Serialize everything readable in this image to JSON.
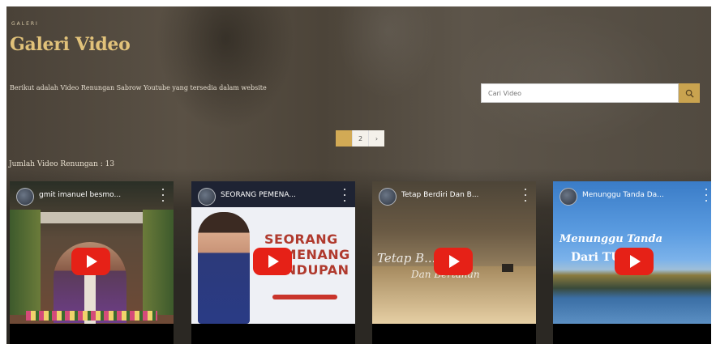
{
  "header": {
    "eyebrow": "GALERI",
    "title": "Galeri Video",
    "description": "Berikut adalah Video Renungan Sabrow Youtube yang tersedia dalam website"
  },
  "search": {
    "placeholder": "Cari Video",
    "icon": "search-icon"
  },
  "pagination": {
    "pages": [
      "1",
      "2",
      "›"
    ],
    "active": "1"
  },
  "count_label": "Jumlah Video Renungan : 13",
  "videos": [
    {
      "title": "gmit imanuel besmo...",
      "thumb_text": "",
      "thumb_text2": ""
    },
    {
      "title": "SEORANG PEMENA...",
      "thumb_text": "SEORANG PEMENANG KANDUPAN",
      "thumb_text2": ""
    },
    {
      "title": "Tetap Berdiri Dan B...",
      "thumb_text": "Tetap B...",
      "thumb_text2": "Dan Bertahan"
    },
    {
      "title": "Menunggu Tanda Da...",
      "thumb_text": "Menunggu Tanda",
      "thumb_text2": "Dari TUHAN"
    }
  ],
  "colors": {
    "accent": "#c9a34f",
    "title": "#e1c27a",
    "play": "#e62117"
  }
}
